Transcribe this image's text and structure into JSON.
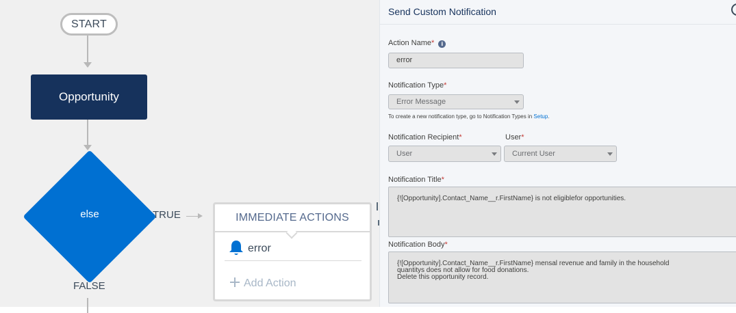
{
  "canvas": {
    "start_label": "START",
    "object_label": "Opportunity",
    "criteria_label": "else",
    "true_label": "TRUE",
    "false_label": "FALSE",
    "actions_card": {
      "header": "IMMEDIATE ACTIONS",
      "action_item": "error",
      "add_action": "Add Action"
    },
    "colors": {
      "object_node": "#16325c",
      "criteria_node": "#0070d2",
      "connector": "#b8b8b8"
    },
    "icons": {
      "action": "bell-icon",
      "add": "plus-icon"
    }
  },
  "panel": {
    "title": "Send Custom Notification",
    "action_name": {
      "label": "Action Name",
      "value": "error"
    },
    "notification_type": {
      "label": "Notification Type",
      "value": "Error Message",
      "help_prefix": "To create a new notification type, go to Notification Types in ",
      "help_link": "Setup",
      "help_suffix": "."
    },
    "recipient": {
      "label": "Notification Recipient",
      "value": "User"
    },
    "user": {
      "label": "User",
      "value": "Current User"
    },
    "notification_title": {
      "label": "Notification Title",
      "value": "{![Opportunity].Contact_Name__r.FirstName} is not eligiblefor opportunities."
    },
    "notification_body": {
      "label": "Notification Body",
      "value_lines": [
        "{![Opportunity].Contact_Name__r.FirstName} mensal revenue and family in the household",
        "quantitys does not allow for food donations.",
        "Delete this opportunity record."
      ]
    },
    "required_marker": "*",
    "info_glyph": "i"
  }
}
